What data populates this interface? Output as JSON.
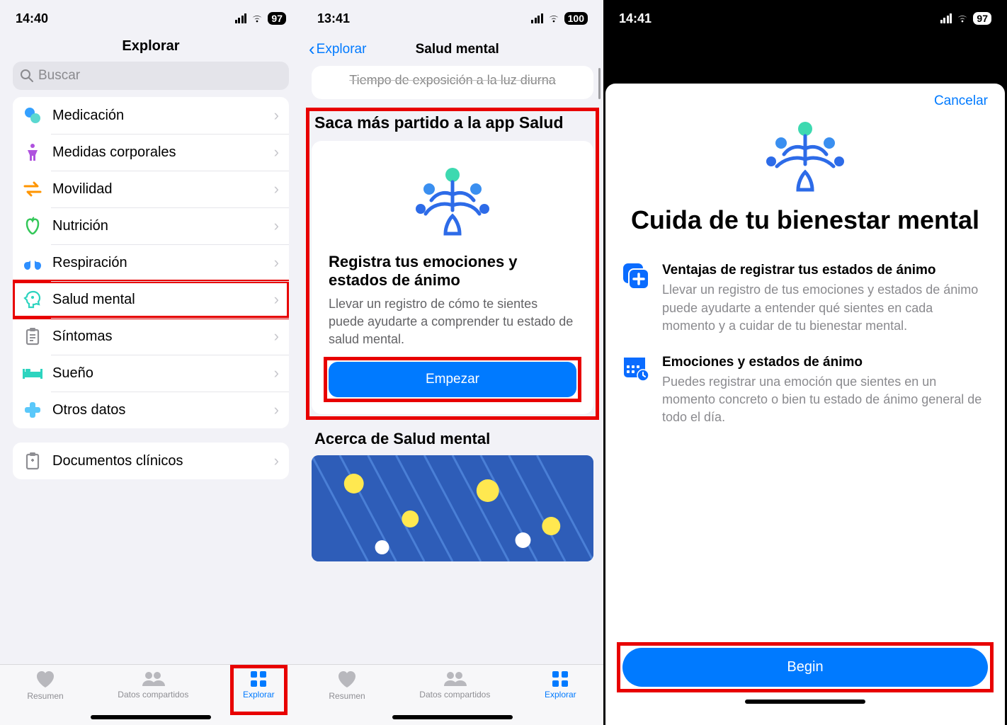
{
  "screen1": {
    "status": {
      "time": "14:40",
      "battery": "97"
    },
    "title": "Explorar",
    "search_placeholder": "Buscar",
    "rows": [
      {
        "label": "Medicación"
      },
      {
        "label": "Medidas corporales"
      },
      {
        "label": "Movilidad"
      },
      {
        "label": "Nutrición"
      },
      {
        "label": "Respiración"
      },
      {
        "label": "Salud mental"
      },
      {
        "label": "Síntomas"
      },
      {
        "label": "Sueño"
      },
      {
        "label": "Otros datos"
      }
    ],
    "clinical_docs": "Documentos clínicos",
    "tabs": {
      "summary": "Resumen",
      "shared": "Datos compartidos",
      "explore": "Explorar"
    }
  },
  "screen2": {
    "status": {
      "time": "13:41",
      "battery": "100"
    },
    "back_label": "Explorar",
    "title": "Salud mental",
    "peek_card": "Tiempo de exposición a la luz diurna",
    "section1": "Saca más partido a la app Salud",
    "card": {
      "heading": "Registra tus emociones y estados de ánimo",
      "body": "Llevar un registro de cómo te sientes puede ayudarte a comprender tu estado de salud mental.",
      "button": "Empezar"
    },
    "section2": "Acerca de Salud mental",
    "tabs": {
      "summary": "Resumen",
      "shared": "Datos compartidos",
      "explore": "Explorar"
    }
  },
  "screen3": {
    "status": {
      "time": "14:41",
      "battery": "97"
    },
    "cancel": "Cancelar",
    "title": "Cuida de tu bienestar mental",
    "info1": {
      "heading": "Ventajas de registrar tus estados de ánimo",
      "body": "Llevar un registro de tus emociones y estados de ánimo puede ayudarte a entender qué sientes en cada momento y a cuidar de tu bienestar mental."
    },
    "info2": {
      "heading": "Emociones y estados de ánimo",
      "body": "Puedes registrar una emoción que sientes en un momento concreto o bien tu estado de ánimo general de todo el día."
    },
    "begin": "Begin"
  }
}
